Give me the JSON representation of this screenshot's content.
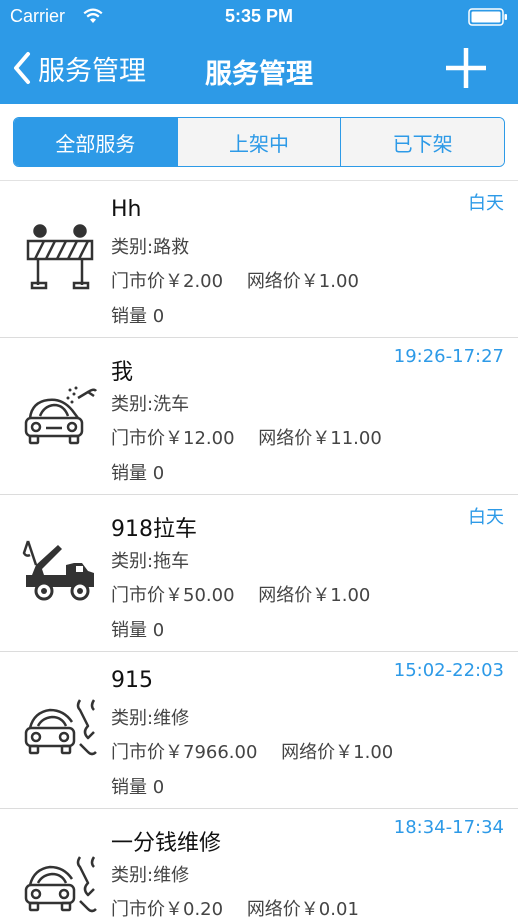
{
  "status_bar": {
    "carrier": "Carrier",
    "time": "5:35 PM"
  },
  "nav": {
    "back_label": "服务管理",
    "title": "服务管理"
  },
  "segments": [
    {
      "label": "全部服务",
      "active": true
    },
    {
      "label": "上架中",
      "active": false
    },
    {
      "label": "已下架",
      "active": false
    }
  ],
  "services": [
    {
      "icon": "roadblock-icon",
      "name": "Hh",
      "category": "类别:路救",
      "store_price": "门市价￥2.00",
      "online_price": "网络价￥1.00",
      "sales": "销量 0",
      "time": "白天"
    },
    {
      "icon": "car-wash-icon",
      "name": "我",
      "category": "类别:洗车",
      "store_price": "门市价￥12.00",
      "online_price": "网络价￥11.00",
      "sales": "销量 0",
      "time": "19:26-17:27"
    },
    {
      "icon": "tow-truck-icon",
      "name": "918拉车",
      "category": "类别:拖车",
      "store_price": "门市价￥50.00",
      "online_price": "网络价￥1.00",
      "sales": "销量 0",
      "time": "白天"
    },
    {
      "icon": "car-repair-icon",
      "name": "915",
      "category": "类别:维修",
      "store_price": "门市价￥7966.00",
      "online_price": "网络价￥1.00",
      "sales": "销量 0",
      "time": "15:02-22:03"
    },
    {
      "icon": "car-repair-icon",
      "name": "一分钱维修",
      "category": "类别:维修",
      "store_price": "门市价￥0.20",
      "online_price": "网络价￥0.01",
      "sales": "",
      "time": "18:34-17:34"
    }
  ],
  "colors": {
    "accent": "#2d9ae7",
    "header_text": "#ffffff"
  }
}
